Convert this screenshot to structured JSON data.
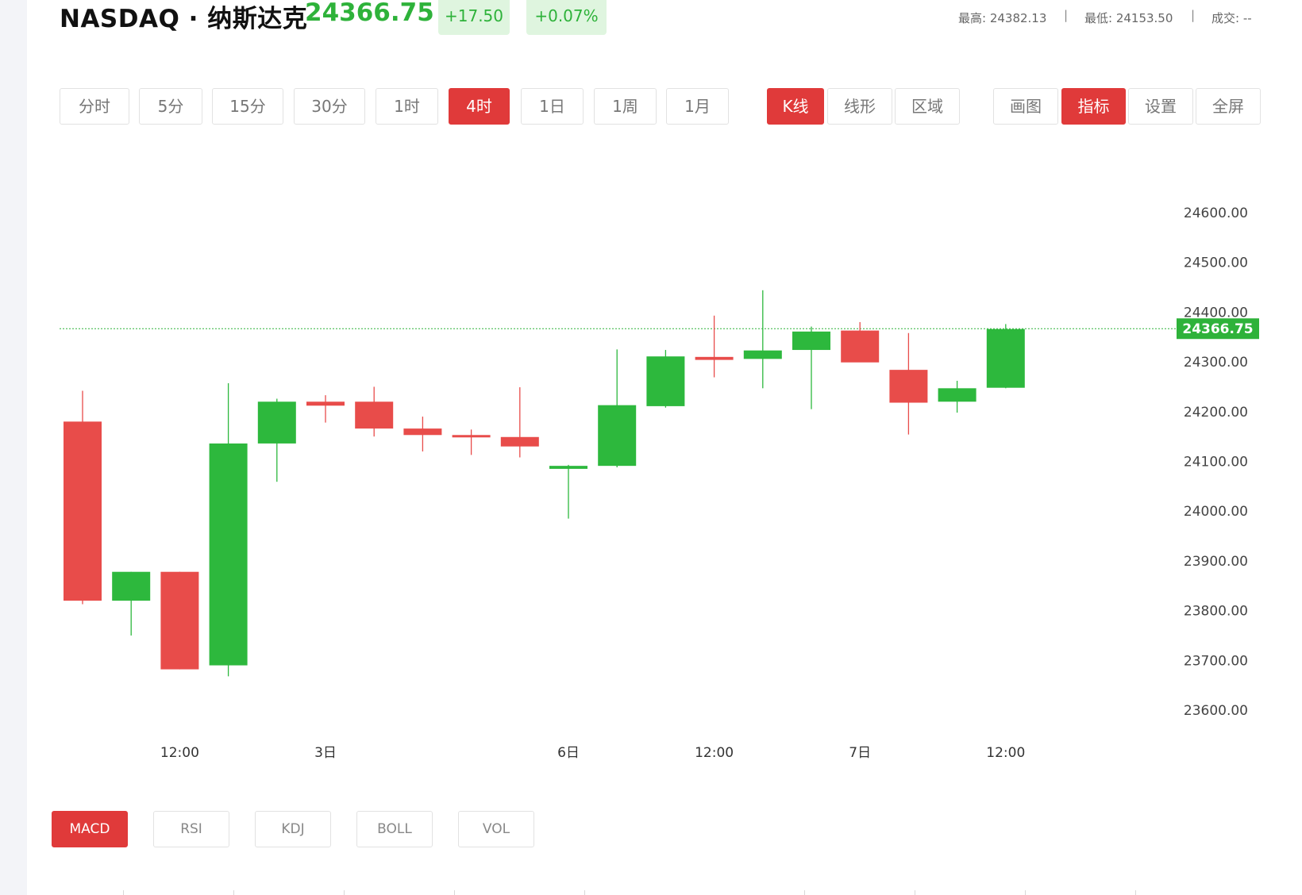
{
  "header": {
    "symbol": "NASDAQ · 纳斯达克",
    "price": "24366.75",
    "change": "+17.50",
    "change_pct": "+0.07%",
    "stats": {
      "high_label": "最高: 24382.13",
      "low_label": "最低: 24153.50",
      "volume_label": "成交: --",
      "sep": "|"
    }
  },
  "periods": [
    {
      "label": "分时",
      "active": false
    },
    {
      "label": "5分",
      "active": false
    },
    {
      "label": "15分",
      "active": false
    },
    {
      "label": "30分",
      "active": false
    },
    {
      "label": "1时",
      "active": false
    },
    {
      "label": "4时",
      "active": true
    },
    {
      "label": "1日",
      "active": false
    },
    {
      "label": "1周",
      "active": false
    },
    {
      "label": "1月",
      "active": false
    }
  ],
  "chart_types": [
    {
      "label": "K线",
      "active": true
    },
    {
      "label": "线形",
      "active": false
    },
    {
      "label": "区域",
      "active": false
    }
  ],
  "tools": [
    {
      "label": "画图",
      "active": false
    },
    {
      "label": "指标",
      "active": true
    },
    {
      "label": "设置",
      "active": false
    },
    {
      "label": "全屏",
      "active": false
    }
  ],
  "indicators": [
    {
      "label": "MACD",
      "active": true
    },
    {
      "label": "RSI",
      "active": false
    },
    {
      "label": "KDJ",
      "active": false
    },
    {
      "label": "BOLL",
      "active": false
    },
    {
      "label": "VOL",
      "active": false
    }
  ],
  "colors": {
    "up": "#2db83d",
    "down": "#e84c4a",
    "accent": "#e03a3a",
    "price_line": "#2eb23a"
  },
  "chart_data": {
    "type": "candlestick",
    "ylim": [
      23600,
      24600
    ],
    "yticks": [
      "24600.00",
      "24500.00",
      "24400.00",
      "24300.00",
      "24200.00",
      "24100.00",
      "24000.00",
      "23900.00",
      "23800.00",
      "23700.00",
      "23600.00"
    ],
    "xticks": [
      {
        "label": "12:00",
        "index": 2
      },
      {
        "label": "3日",
        "index": 5
      },
      {
        "label": "6日",
        "index": 10
      },
      {
        "label": "12:00",
        "index": 13
      },
      {
        "label": "7日",
        "index": 16
      },
      {
        "label": "12:00",
        "index": 19
      }
    ],
    "current_price": 24366.75,
    "current_price_label": "24366.75",
    "candles": [
      {
        "open": 24180,
        "high": 24242,
        "low": 23813,
        "close": 23820
      },
      {
        "open": 23820,
        "high": 23878,
        "low": 23750,
        "close": 23878
      },
      {
        "open": 23878,
        "high": 23878,
        "low": 23682,
        "close": 23682
      },
      {
        "open": 23690,
        "high": 24257,
        "low": 23668,
        "close": 24136
      },
      {
        "open": 24136,
        "high": 24226,
        "low": 24059,
        "close": 24220
      },
      {
        "open": 24220,
        "high": 24233,
        "low": 24178,
        "close": 24212
      },
      {
        "open": 24220,
        "high": 24250,
        "low": 24150,
        "close": 24166
      },
      {
        "open": 24166,
        "high": 24190,
        "low": 24120,
        "close": 24153
      },
      {
        "open": 24153,
        "high": 24164,
        "low": 24113,
        "close": 24149
      },
      {
        "open": 24149,
        "high": 24249,
        "low": 24108,
        "close": 24130
      },
      {
        "open": 24085,
        "high": 24093,
        "low": 23985,
        "close": 24091
      },
      {
        "open": 24091,
        "high": 24325,
        "low": 24088,
        "close": 24213
      },
      {
        "open": 24211,
        "high": 24324,
        "low": 24208,
        "close": 24311
      },
      {
        "open": 24310,
        "high": 24393,
        "low": 24269,
        "close": 24304
      },
      {
        "open": 24306,
        "high": 24444,
        "low": 24247,
        "close": 24323
      },
      {
        "open": 24324,
        "high": 24371,
        "low": 24205,
        "close": 24361
      },
      {
        "open": 24363,
        "high": 24380,
        "low": 24300,
        "close": 24299
      },
      {
        "open": 24284,
        "high": 24358,
        "low": 24154,
        "close": 24218
      },
      {
        "open": 24220,
        "high": 24262,
        "low": 24198,
        "close": 24247
      },
      {
        "open": 24248,
        "high": 24376,
        "low": 24247,
        "close": 24366
      }
    ]
  }
}
